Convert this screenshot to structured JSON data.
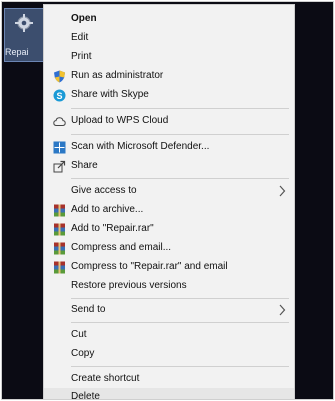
{
  "desktop": {
    "icon_label": "Repai"
  },
  "menu": {
    "items": [
      {
        "label": "Open",
        "icon": "none"
      },
      {
        "label": "Edit",
        "icon": "none"
      },
      {
        "label": "Print",
        "icon": "none"
      },
      {
        "label": "Run as administrator",
        "icon": "shield-icon"
      },
      {
        "label": "Share with Skype",
        "icon": "skype-icon"
      },
      {
        "label": "Upload to WPS Cloud",
        "icon": "cloud-icon"
      },
      {
        "label": "Scan with Microsoft Defender...",
        "icon": "defender-icon"
      },
      {
        "label": "Share",
        "icon": "share-icon"
      },
      {
        "label": "Give access to",
        "icon": "none"
      },
      {
        "label": "Add to archive...",
        "icon": "winrar-icon"
      },
      {
        "label": "Add to \"Repair.rar\"",
        "icon": "winrar-icon"
      },
      {
        "label": "Compress and email...",
        "icon": "winrar-icon"
      },
      {
        "label": "Compress to \"Repair.rar\" and email",
        "icon": "winrar-icon"
      },
      {
        "label": "Restore previous versions",
        "icon": "none"
      },
      {
        "label": "Send to",
        "icon": "none"
      },
      {
        "label": "Cut",
        "icon": "none"
      },
      {
        "label": "Copy",
        "icon": "none"
      },
      {
        "label": "Create shortcut",
        "icon": "none"
      },
      {
        "label": "Delete",
        "icon": "none"
      }
    ]
  },
  "colors": {
    "menu_bg": "#f2f2f2",
    "hover_bg": "#e6e6e6",
    "desktop_bg": "#0b0b14",
    "skype_blue": "#1a9ad6",
    "defender_blue": "#2b78c5",
    "shield_blue": "#2e6fd2",
    "shield_yellow": "#f2c230",
    "winrar_red": "#a8322b"
  }
}
